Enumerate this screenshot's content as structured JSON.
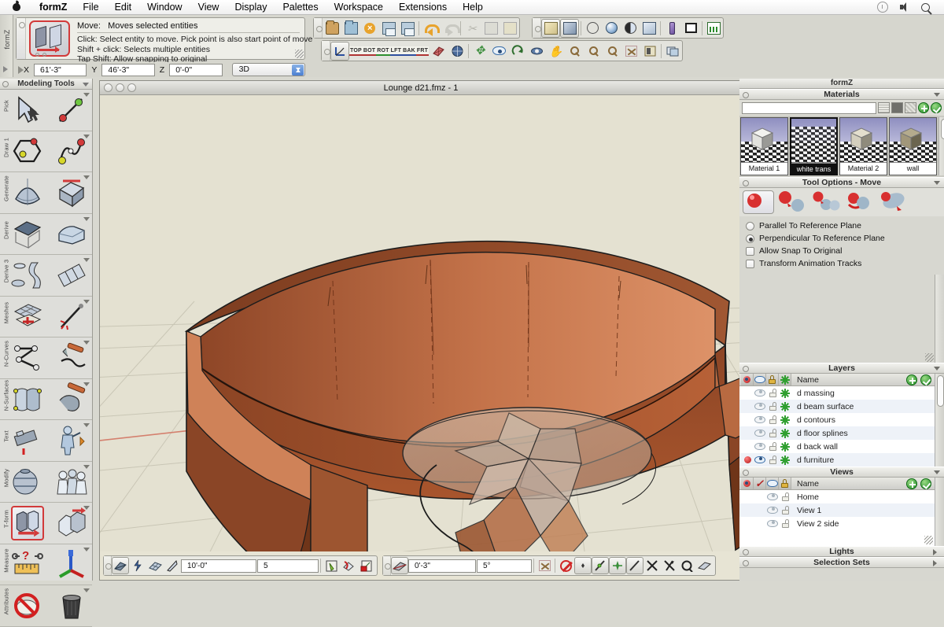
{
  "menubar": {
    "apple_icon": "apple-logo",
    "items": [
      "formZ",
      "File",
      "Edit",
      "Window",
      "View",
      "Display",
      "Palettes",
      "Workspace",
      "Extensions",
      "Help"
    ],
    "right_icons": [
      "clock-icon",
      "volume-icon",
      "search-icon"
    ]
  },
  "tool_info": {
    "vertical_tab_label": "formZ",
    "tool_name": "Move:",
    "tool_desc": "Moves selected entities",
    "hints": [
      "Click: Select entity to move. Pick point is also start point of move",
      "Shift + click: Selects multiple entities",
      "Tap Shift: Allow snapping to original"
    ]
  },
  "coordinates": {
    "x_label": "X",
    "x_value": "61'-3\"",
    "y_label": "Y",
    "y_value": "46'-3\"",
    "z_label": "Z",
    "z_value": "0'-0\"",
    "mode": "3D"
  },
  "toolbar_top": {
    "file_group": [
      "open-folder-icon",
      "new-folder-icon",
      "close-x-icon",
      "save-icon",
      "save-as-icon",
      "undo-icon",
      "redo-icon",
      "cut-icon",
      "copy-icon",
      "paste-icon"
    ],
    "display_group": [
      "wireframe-icon",
      "hidden-line-icon",
      "wire-shaded-icon",
      "shaded-render-icon",
      "shaded-work-icon",
      "renderzone-icon",
      "pen-render-icon",
      "sketch-render-icon",
      "chart-render-icon"
    ]
  },
  "toolbar_views": {
    "items": [
      "reference-plane-icon",
      "TOP",
      "BOT",
      "ROT",
      "LFT",
      "BAK",
      "FRT",
      "axonometric-icon",
      "perspective-icon",
      "move-view-icon",
      "look-icon",
      "rotate-view-icon",
      "orbit-icon",
      "pan-icon",
      "zoom-icon",
      "zoom-in-icon",
      "zoom-out-icon",
      "fit-all-icon",
      "window-zoom-icon",
      "layout-icon"
    ]
  },
  "modeling_tools": {
    "title": "Modeling Tools",
    "groups": [
      {
        "label": "Pick",
        "tools": [
          "pick-arrow-tool",
          "pick-point-tool"
        ]
      },
      {
        "label": "Draw 1",
        "tools": [
          "polygon-tool",
          "spline-tool"
        ]
      },
      {
        "label": "Generate",
        "tools": [
          "primitive-tool",
          "extrude-tool"
        ]
      },
      {
        "label": "Derive",
        "tools": [
          "derive-surface-tool",
          "derive-solid-tool"
        ]
      },
      {
        "label": "Derive 3",
        "tools": [
          "lathe-tool",
          "segment-tool"
        ]
      },
      {
        "label": "Meshes",
        "tools": [
          "mesh-tool",
          "smooth-tool"
        ]
      },
      {
        "label": "N-Curves",
        "tools": [
          "nurbs-curve-tool",
          "curve-edit-tool"
        ]
      },
      {
        "label": "N-Surfaces",
        "tools": [
          "nurbs-surface-tool",
          "surface-edit-tool"
        ]
      },
      {
        "label": "Text",
        "tools": [
          "text-tool",
          "figure-tool"
        ]
      },
      {
        "label": "Modify",
        "tools": [
          "modify-sphere-tool",
          "group-tool"
        ]
      },
      {
        "label": "T-form",
        "tools": [
          "move-tool",
          "copy-transform-tool"
        ]
      },
      {
        "label": "Measure",
        "tools": [
          "measure-tool",
          "axes-tool"
        ]
      },
      {
        "label": "Attributes",
        "tools": [
          "no-attribute-tool",
          "trash-tool"
        ]
      }
    ],
    "active_group": "T-form",
    "active_tool": "move-tool"
  },
  "document": {
    "title": "Lounge d21.fmz - 1",
    "window_buttons": [
      "close-button",
      "minimize-button",
      "zoom-button"
    ]
  },
  "status_bar": {
    "left_group": {
      "icons": [
        "reference-plane-icon",
        "snap-icon",
        "grid-icon",
        "direction-icon"
      ],
      "field1": "10'-0\"",
      "field2": "5",
      "icons_right": [
        "perpendicular-snap-icon",
        "angle-snap-icon",
        "lock-snap-icon"
      ]
    },
    "right_group": {
      "icons": [
        "plane-icon"
      ],
      "field1": "0'-3\"",
      "field2": "5°",
      "icons_right": [
        "no-snap-icon",
        "none-icon",
        "point-snap-icon",
        "segment-snap-icon",
        "midpoint-snap-icon",
        "line-snap-icon",
        "intersection-snap-icon",
        "tangent-snap-icon",
        "center-snap-icon",
        "surface-snap-icon"
      ]
    }
  },
  "right_palette": {
    "title": "formZ",
    "materials": {
      "header": "Materials",
      "search_placeholder": "",
      "view_modes": [
        "list-view-icon",
        "thumbnail-view-icon",
        "grid-view-icon"
      ],
      "add_label": "add-material-button",
      "apply_label": "apply-material-button",
      "swatches": [
        {
          "name": "Material 1",
          "selected": false,
          "color": "#e8e8e4"
        },
        {
          "name": "white trans",
          "selected": true,
          "color": "#f4f4f0"
        },
        {
          "name": "Material 2",
          "selected": false,
          "color": "#ded8c8"
        },
        {
          "name": "wall",
          "selected": false,
          "color": "#a89c7c"
        }
      ]
    },
    "tool_options": {
      "header": "Tool Options - Move",
      "mode_icons": [
        "move-self-icon",
        "move-copy-icon",
        "move-multi-copy-icon",
        "move-repeat-icon",
        "move-continuous-icon"
      ],
      "selected_mode_index": 0,
      "options": [
        {
          "label": "Parallel To Reference Plane",
          "type": "radio",
          "checked": false
        },
        {
          "label": "Perpendicular To Reference Plane",
          "type": "radio",
          "checked": true
        },
        {
          "label": "Allow Snap To Original",
          "type": "checkbox",
          "checked": false
        },
        {
          "label": "Transform Animation Tracks",
          "type": "checkbox",
          "checked": false
        }
      ]
    },
    "layers": {
      "header": "Layers",
      "columns": [
        "active-col",
        "visible-col",
        "lock-col",
        "light-col",
        "Name"
      ],
      "name_header": "Name",
      "rows": [
        {
          "name": "d massing",
          "active": false,
          "visible": false,
          "locked": false
        },
        {
          "name": "d beam surface",
          "active": false,
          "visible": false,
          "locked": false
        },
        {
          "name": "d contours",
          "active": false,
          "visible": false,
          "locked": false
        },
        {
          "name": "d floor splines",
          "active": false,
          "visible": false,
          "locked": false
        },
        {
          "name": "d back wall",
          "active": false,
          "visible": false,
          "locked": false
        },
        {
          "name": "d furniture",
          "active": true,
          "visible": true,
          "locked": false
        }
      ]
    },
    "views": {
      "header": "Views",
      "name_header": "Name",
      "columns": [
        "active-col",
        "check-col",
        "visible-col",
        "lock-col",
        "Name"
      ],
      "rows": [
        {
          "name": "Home"
        },
        {
          "name": "View 1"
        },
        {
          "name": "View 2 side"
        }
      ]
    },
    "lights": {
      "header": "Lights"
    },
    "selection_sets": {
      "header": "Selection Sets"
    }
  },
  "colors": {
    "accent_red": "#d23a3a",
    "viewport_bg": "#e4e1d1",
    "furniture_wood": "#a9522e",
    "furniture_wood_light": "#d98a5e",
    "chrome": "#d7d7d0",
    "green_button": "#1f8c26"
  }
}
